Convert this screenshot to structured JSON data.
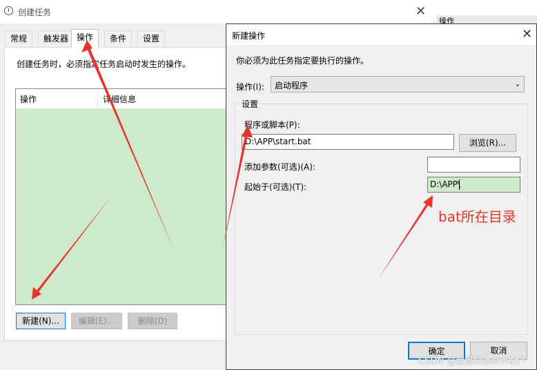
{
  "main_window": {
    "title": "创建任务",
    "tabs": [
      "常规",
      "触发器",
      "操作",
      "条件",
      "设置"
    ],
    "active_tab": "操作",
    "description": "创建任务时，必须指定任务启动时发生的操作。",
    "columns": [
      "操作",
      "详细信息"
    ],
    "buttons": {
      "new": "新建(N)...",
      "edit": "编辑(E)...",
      "delete": "删除(D)"
    },
    "right_panel_header": "操作"
  },
  "dialog": {
    "title": "新建操作",
    "instruction": "你必须为此任务指定要执行的操作。",
    "action_label": "操作(I):",
    "action_value": "启动程序",
    "settings_group": "设置",
    "program_label": "程序或脚本(P):",
    "program_value": "D:\\APP\\start.bat",
    "browse_button": "浏览(R)...",
    "args_label": "添加参数(可选)(A):",
    "args_value": "",
    "start_in_label": "起始于(可选)(T):",
    "start_in_value": "D:\\APP\\",
    "ok_button": "确定",
    "cancel_button": "取消"
  },
  "annotation": {
    "text": "bat所在目录",
    "color": "#e8322b"
  },
  "watermark": "CSDN @我是Superman丶",
  "colors": {
    "highlight_green": "#cdeacb",
    "accent_blue": "#0078d7"
  }
}
